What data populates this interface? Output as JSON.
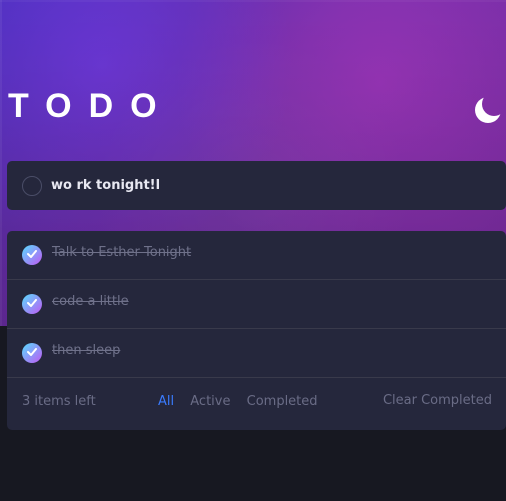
{
  "app": {
    "title": "TODO"
  },
  "colors": {
    "accent": "#3a7bfd",
    "panel": "#25273c",
    "checkbox_gradient": [
      "#57ddff",
      "#c058f3"
    ],
    "muted_text": "#6f718a"
  },
  "icons": {
    "theme_toggle": "moon-icon",
    "checked": "check-icon"
  },
  "new_todo": {
    "value": "wo rk tonight!l"
  },
  "todos": [
    {
      "label": "Talk to Esther Tonight",
      "completed": true
    },
    {
      "label": "code a little",
      "completed": true
    },
    {
      "label": "then sleep",
      "completed": true
    }
  ],
  "footer": {
    "items_left": "3 items left",
    "filters": {
      "all": "All",
      "active": "Active",
      "completed": "Completed"
    },
    "clear_completed": "Clear Completed"
  }
}
